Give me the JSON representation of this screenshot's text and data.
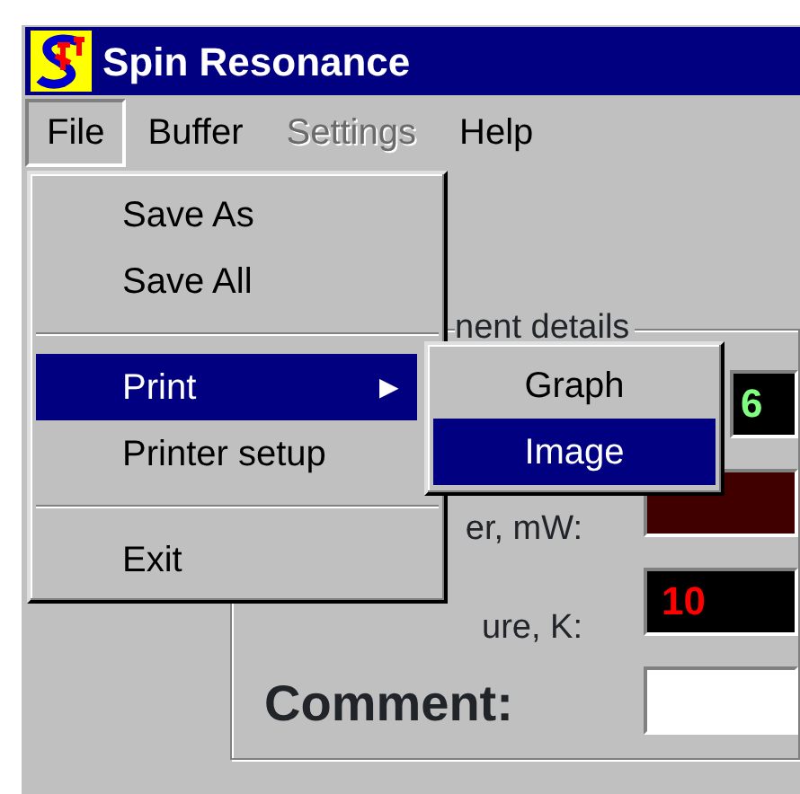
{
  "window": {
    "title": "Spin Resonance"
  },
  "menu_bar": [
    {
      "label": "File",
      "selected": true,
      "disabled": false
    },
    {
      "label": "Buffer",
      "selected": false,
      "disabled": false
    },
    {
      "label": "Settings",
      "selected": false,
      "disabled": true
    },
    {
      "label": "Help",
      "selected": false,
      "disabled": false
    }
  ],
  "file_menu": [
    {
      "kind": "item",
      "label": "Save As",
      "selected": false
    },
    {
      "kind": "item",
      "label": "Save All",
      "selected": false
    },
    {
      "kind": "separator"
    },
    {
      "kind": "submenu",
      "label": "Print",
      "selected": true,
      "arrow": "▶"
    },
    {
      "kind": "item",
      "label": "Printer setup",
      "selected": false
    },
    {
      "kind": "separator"
    },
    {
      "kind": "item",
      "label": "Exit",
      "selected": false
    }
  ],
  "print_submenu": [
    {
      "label": "Graph",
      "selected": false
    },
    {
      "label": "Image",
      "selected": true
    }
  ],
  "group": {
    "legend": "nent details",
    "fields": [
      {
        "kind": "gauge",
        "value": "6",
        "color": "#80ff80"
      },
      {
        "kind": "level",
        "label": "er, mW:"
      },
      {
        "kind": "readout",
        "label": "ure, K:",
        "value": "10",
        "color": "#ff0000"
      },
      {
        "kind": "input",
        "label": "Comment:"
      }
    ]
  }
}
